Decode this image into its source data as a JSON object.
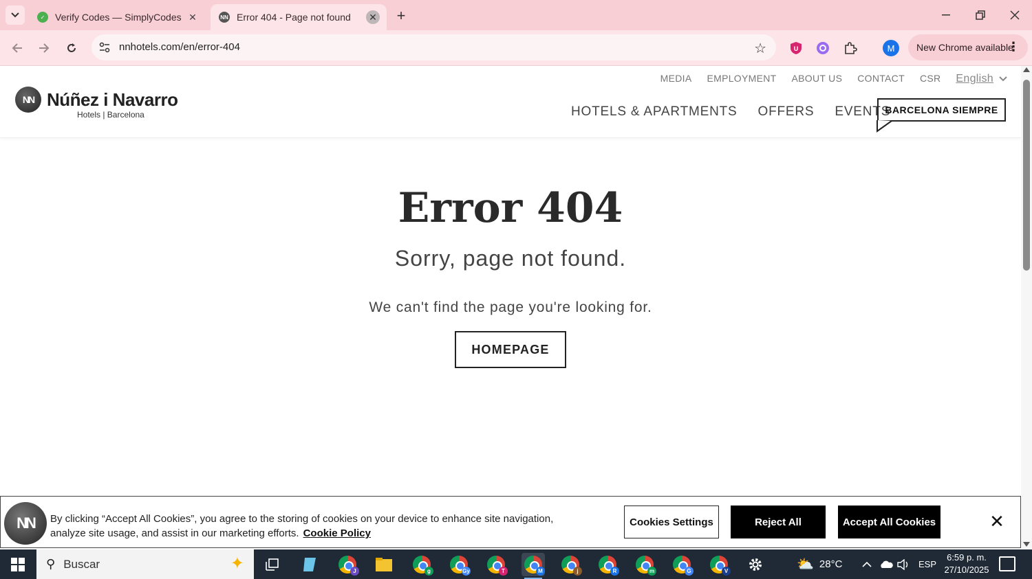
{
  "browser": {
    "tabs": [
      {
        "title": "Verify Codes — SimplyCodes",
        "favicon": "simplycodes-icon",
        "active": false
      },
      {
        "title": "Error 404 - Page not found",
        "favicon": "nn-icon",
        "active": true
      }
    ],
    "url": "nnhotels.com/en/error-404",
    "new_chrome_label": "New Chrome available",
    "profile_initial": "M"
  },
  "site": {
    "logo_name": "Núñez i Navarro",
    "logo_sub": "Hotels | Barcelona",
    "logo_mark": "NN",
    "top_links": [
      "MEDIA",
      "EMPLOYMENT",
      "ABOUT US",
      "CONTACT",
      "CSR"
    ],
    "language": "English",
    "main_nav": [
      "HOTELS & APARTMENTS",
      "OFFERS",
      "EVENTS"
    ],
    "cta": "BARCELONA SIEMPRE"
  },
  "error": {
    "title": "Error 404",
    "subtitle": "Sorry, page not found.",
    "message": "We can't find the page you're looking for.",
    "button": "HOMEPAGE"
  },
  "cookie_banner": {
    "text": "By clicking “Accept All Cookies”, you agree to the storing of cookies on your device to enhance site navigation, analyze site usage, and assist in our marketing efforts.",
    "policy_link": "Cookie Policy",
    "settings_button": "Cookies Settings",
    "reject_button": "Reject All",
    "accept_button": "Accept All Cookies"
  },
  "taskbar": {
    "search_placeholder": "Buscar",
    "chrome_badges": [
      "J",
      "g",
      "Gy",
      "T",
      "M",
      "j",
      "R",
      "m",
      "G",
      "V"
    ],
    "active_badge": "M",
    "weather": "28°C",
    "language": "ESP",
    "time": "6:59 p. m.",
    "date": "27/10/2025"
  },
  "colors": {
    "tabstrip": "#f9cfd6",
    "toolbar": "#fde4e8",
    "taskbar": "#1f2a36"
  }
}
